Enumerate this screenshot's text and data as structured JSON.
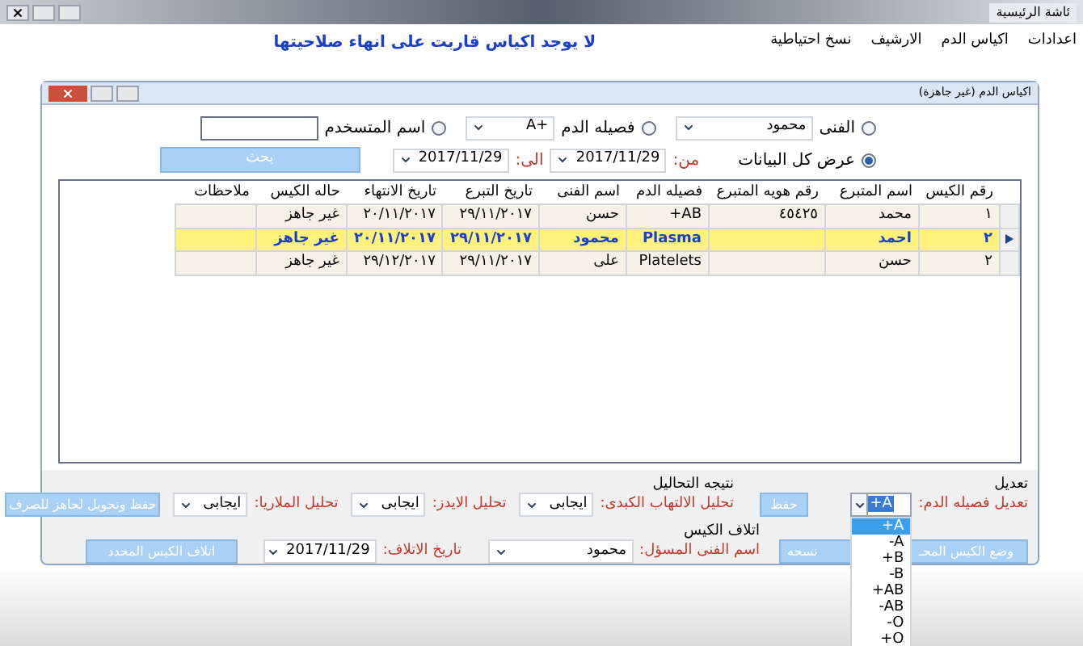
{
  "window": {
    "title": "ئاشة الرئيسية"
  },
  "menu": [
    "اعدادات",
    "اكياس الدم",
    "الارشيف",
    "نسخ احتياطية"
  ],
  "alert": "لا يوجد اكياس قاربت على انهاء صلاحيتها",
  "dialog": {
    "title": "اكياس الدم (غير جاهزة)"
  },
  "filters": [
    {
      "label": "الفنى",
      "selected": false,
      "kind": "combo",
      "value": "محمود"
    },
    {
      "label": "فصيله الدم",
      "selected": false,
      "kind": "combo",
      "value": "A+"
    },
    {
      "label": "اسم المتسخدم",
      "selected": false,
      "kind": "text"
    }
  ],
  "show_all": {
    "label": "عرض كل البيانات",
    "selected": true
  },
  "from": {
    "label": "من:",
    "value": "2017/11/29"
  },
  "to": {
    "label": "الى:",
    "value": "2017/11/29"
  },
  "search_button": "بحث",
  "table": {
    "columns": [
      "رقم الكيس",
      "اسم المتبرع",
      "رقم هويه المتبرع",
      "فصيله الدم",
      "اسم الفنى",
      "تاريخ التبرع",
      "تاريخ الانتهاء",
      "حاله الكيس",
      "ملاحظات"
    ],
    "rows": [
      {
        "selected": false,
        "cells": [
          "١",
          "محمد",
          "٤٥٤٢٥",
          "+AB",
          "حسن",
          "٢٩/١١/٢٠١٧",
          "٢٠/١١/٢٠١٧",
          "غير جاهز",
          null
        ]
      },
      {
        "selected": true,
        "cells": [
          "٢",
          "احمد",
          null,
          "Plasma",
          "محمود",
          "٢٩/١١/٢٠١٧",
          "٢٠/١١/٢٠١٧",
          "غير جاهز",
          null
        ]
      },
      {
        "selected": false,
        "cells": [
          "٢",
          "حسن",
          null,
          "Platelets",
          "على",
          "٢٩/١١/٢٠١٧",
          "٢٩/١٢/٢٠١٧",
          "غير جاهز",
          null
        ]
      }
    ]
  },
  "edit": {
    "title": "تعديل",
    "label": "تعديل فصيله الدم:",
    "value": "+A",
    "save": "حفظ",
    "move_button": [
      "وضع الكيس المحـ",
      "نسحه"
    ],
    "options": [
      {
        "label": "+A",
        "selected": true
      },
      {
        "label": "-A",
        "selected": false
      },
      {
        "label": "+B",
        "selected": false
      },
      {
        "label": "-B",
        "selected": false
      },
      {
        "label": "+AB",
        "selected": false
      },
      {
        "label": "-AB",
        "selected": false
      },
      {
        "label": "-O",
        "selected": false
      },
      {
        "label": "+O",
        "selected": false
      }
    ]
  },
  "tests": {
    "title": "نتيجه التحاليل",
    "items": [
      {
        "label": "تحليل الالتهاب الكبدى:",
        "value": "ايجابى"
      },
      {
        "label": "تحليل الايدز:",
        "value": "ايجابى"
      },
      {
        "label": "تحليل الملاريا:",
        "value": "ايجابى"
      }
    ],
    "button": "حفظ وتحويل لجاهز للصرف"
  },
  "destroy": {
    "title": "اتلاف الكيس",
    "tech_label": "اسم الفنى المسؤل:",
    "tech": "محمود",
    "date_label": "تاريخ الاتلاف:",
    "date": "2017/11/29",
    "button": "اتلاف الكيس المحدد"
  }
}
